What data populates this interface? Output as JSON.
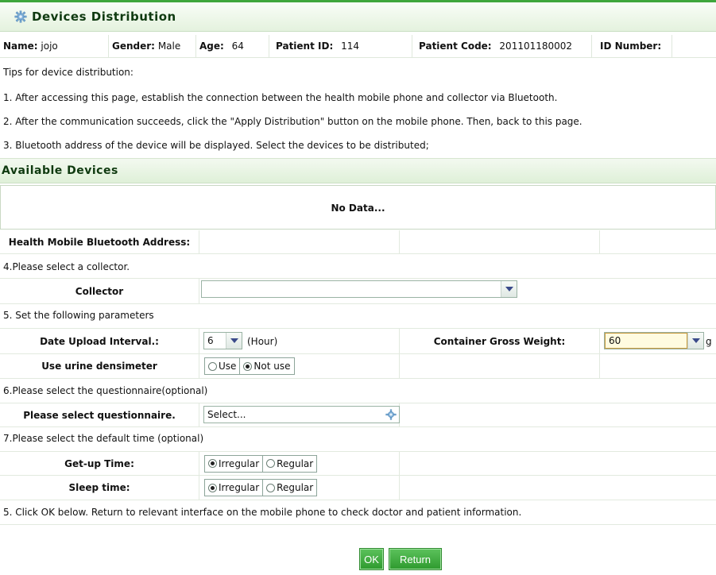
{
  "header": {
    "title": "Devices Distribution",
    "icon": "gear-icon"
  },
  "patient": {
    "name_label": "Name:",
    "name": "jojo",
    "gender_label": "Gender:",
    "gender": "Male",
    "age_label": "Age:",
    "age": "64",
    "patient_id_label": "Patient ID:",
    "patient_id": "114",
    "patient_code_label": "Patient Code:",
    "patient_code": "201101180002",
    "id_number_label": "ID Number:",
    "id_number": ""
  },
  "tips": {
    "heading": "Tips for device distribution:",
    "line1": "1. After accessing this page, establish the connection between the health mobile phone and collector via Bluetooth.",
    "line2": "2. After the communication succeeds, click the \"Apply Distribution\" button on the mobile phone. Then, back to this page.",
    "line3": "3. Bluetooth address of the device will be displayed. Select the devices to be distributed;"
  },
  "available": {
    "title": "Available Devices",
    "no_data": "No Data...",
    "bluetooth_label": "Health Mobile Bluetooth Address:"
  },
  "collector": {
    "step": "4.Please select a collector.",
    "label": "Collector",
    "value": ""
  },
  "parameters": {
    "step": "5. Set the following parameters",
    "upload_label": "Date Upload Interval.:",
    "upload_value": "6",
    "upload_unit": "(Hour)",
    "weight_label": "Container Gross Weight:",
    "weight_value": "60",
    "weight_unit": "g",
    "densimeter_label": "Use urine densimeter",
    "densimeter_options": [
      "Use",
      "Not use"
    ],
    "densimeter_selected": "Not use"
  },
  "questionnaire": {
    "step": "6.Please select the questionnaire(optional)",
    "label": "Please select questionnaire.",
    "value": "Select..."
  },
  "default_time": {
    "step": "7.Please select the default time (optional)",
    "getup_label": "Get-up Time:",
    "sleep_label": "Sleep time:",
    "options": [
      "Irregular",
      "Regular"
    ],
    "getup_selected": "Irregular",
    "sleep_selected": "Irregular"
  },
  "footer": {
    "note": "5. Click OK below. Return to relevant interface on the mobile phone to check doctor and patient information.",
    "ok_label": "OK",
    "return_label": "Return"
  },
  "colors": {
    "accent": "#3fa63c",
    "title_text": "#0f3a10",
    "section_bg": "#dff0d8"
  }
}
